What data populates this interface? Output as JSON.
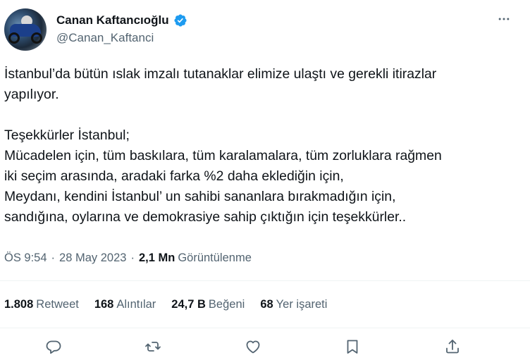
{
  "author": {
    "display_name": "Canan Kaftancıoğlu",
    "handle": "@Canan_Kaftanci",
    "verified": true
  },
  "tweet": {
    "text": "İstanbul’da bütün ıslak imzalı tutanaklar elimize ulaştı ve gerekli itirazlar\nyapılıyor.\n\nTeşekkürler İstanbul;\nMücadelen için, tüm baskılara, tüm karalamalara, tüm zorluklara rağmen\niki seçim arasında, aradaki farka %2 daha eklediğin için,\nMeydanı, kendini İstanbul’ un sahibi sananlara bırakmadığın için,\nsandığına, oylarına ve demokrasiye sahip çıktığın için teşekkürler.."
  },
  "meta": {
    "time": "ÖS 9:54",
    "separator": "·",
    "date": "28 May 2023",
    "views_count": "2,1 Mn",
    "views_label": "Görüntülenme"
  },
  "stats": [
    {
      "num": "1.808",
      "label": "Retweet"
    },
    {
      "num": "168",
      "label": "Alıntılar"
    },
    {
      "num": "24,7 B",
      "label": "Beğeni"
    },
    {
      "num": "68",
      "label": "Yer işareti"
    }
  ],
  "colors": {
    "verified": "#1d9bf0",
    "text_primary": "#0f1419",
    "text_secondary": "#536471",
    "divider": "#eff3f4"
  },
  "icons": {
    "more": "more-horizontal-icon",
    "reply": "reply-icon",
    "retweet": "retweet-icon",
    "like": "heart-icon",
    "bookmark": "bookmark-icon",
    "share": "share-icon"
  }
}
